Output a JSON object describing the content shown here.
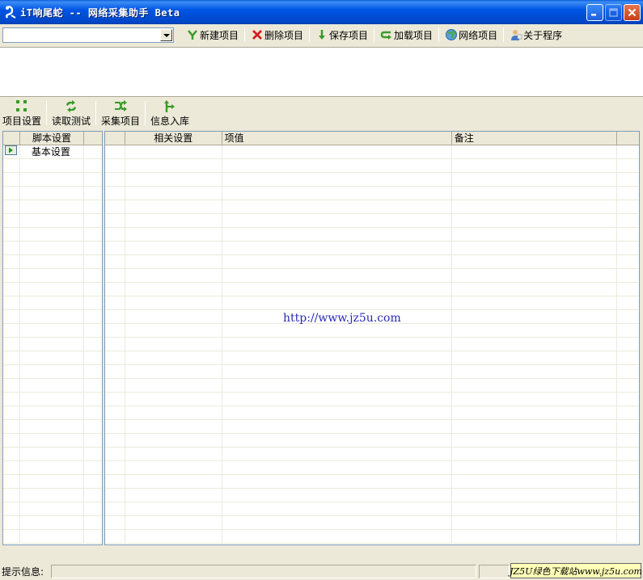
{
  "window": {
    "title": "iT响尾蛇 -- 网络采集助手 Beta",
    "controls": [
      "minimize-icon",
      "maximize-icon",
      "close-icon"
    ]
  },
  "toolbar": {
    "combo_value": "",
    "buttons": [
      {
        "label": "新建项目",
        "icon": "new-project-icon"
      },
      {
        "label": "删除项目",
        "icon": "delete-icon"
      },
      {
        "label": "保存项目",
        "icon": "save-arrow-icon"
      },
      {
        "label": "加载项目",
        "icon": "load-icon"
      },
      {
        "label": "网络项目",
        "icon": "globe-icon"
      },
      {
        "label": "关于程序",
        "icon": "about-icon"
      }
    ]
  },
  "subtoolbar": {
    "buttons": [
      {
        "label": "项目设置",
        "icon": "settings-grid-icon"
      },
      {
        "label": "读取测试",
        "icon": "refresh-icon"
      },
      {
        "label": "采集项目",
        "icon": "shuffle-icon"
      },
      {
        "label": "信息入库",
        "icon": "import-icon"
      }
    ]
  },
  "left_grid": {
    "header": "脚本设置",
    "rows": [
      {
        "label": "基本设置"
      }
    ]
  },
  "right_grid": {
    "columns": [
      "相关设置",
      "项值",
      "备注"
    ]
  },
  "watermark_text": "http://www.jz5u.com",
  "status": {
    "label": "提示信息:",
    "message": "",
    "badge": "JZ5U绿色下载站www.jz5u.com"
  }
}
